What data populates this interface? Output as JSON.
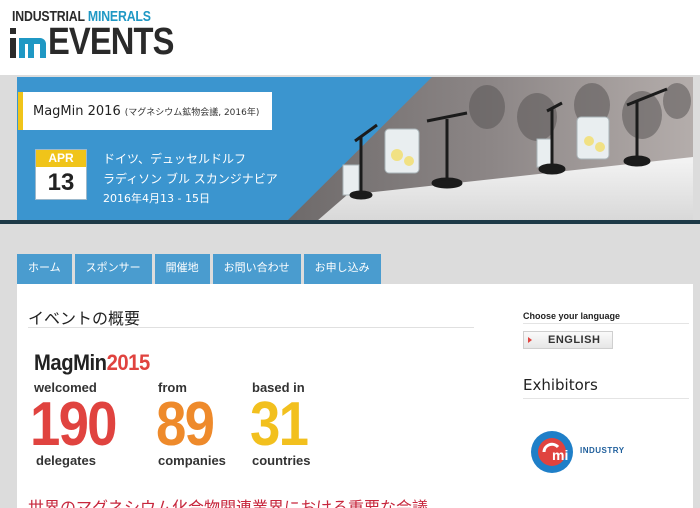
{
  "header": {
    "logo_line1_word1": "INDUSTRIAL",
    "logo_line1_word2": "MINERALS",
    "logo_line2": "EVENTS"
  },
  "banner": {
    "event_name": "MagMin 2016",
    "event_subtitle": "(マグネシウム鉱物会議, 2016年)",
    "calendar_month": "APR",
    "calendar_day": "13",
    "location_line1": "ドイツ、デュッセルドルフ",
    "location_line2": "ラディソン ブル スカンジナビア",
    "date_range": "2016年4月13 - 15日"
  },
  "nav": {
    "items": [
      "ホーム",
      "スポンサー",
      "開催地",
      "お問い合わせ",
      "お申し込み"
    ]
  },
  "overview": {
    "title": "イベントの概要",
    "magmin_word": "MagMin",
    "magmin_year": "2015",
    "stats": [
      {
        "top": "welcomed",
        "value": "190",
        "bottom": "delegates"
      },
      {
        "top": "from",
        "value": "89",
        "bottom": "companies"
      },
      {
        "top": "based in",
        "value": "31",
        "bottom": "countries"
      }
    ],
    "heading_jp": "世界のマグネシウム化合物関連業界における重要な会議"
  },
  "sidebar": {
    "language_label": "Choose your language",
    "language_button": "ENGLISH",
    "exhibitors_title": "Exhibitors",
    "exhibitor_logo_text": "INDUSTRY"
  },
  "colors": {
    "brand_blue": "#1f98c4",
    "nav_blue": "#4a9ccf",
    "accent_yellow": "#f2c01e",
    "accent_red": "#e0433f",
    "accent_orange": "#ee8a2b",
    "heading_red": "#c7273d"
  }
}
